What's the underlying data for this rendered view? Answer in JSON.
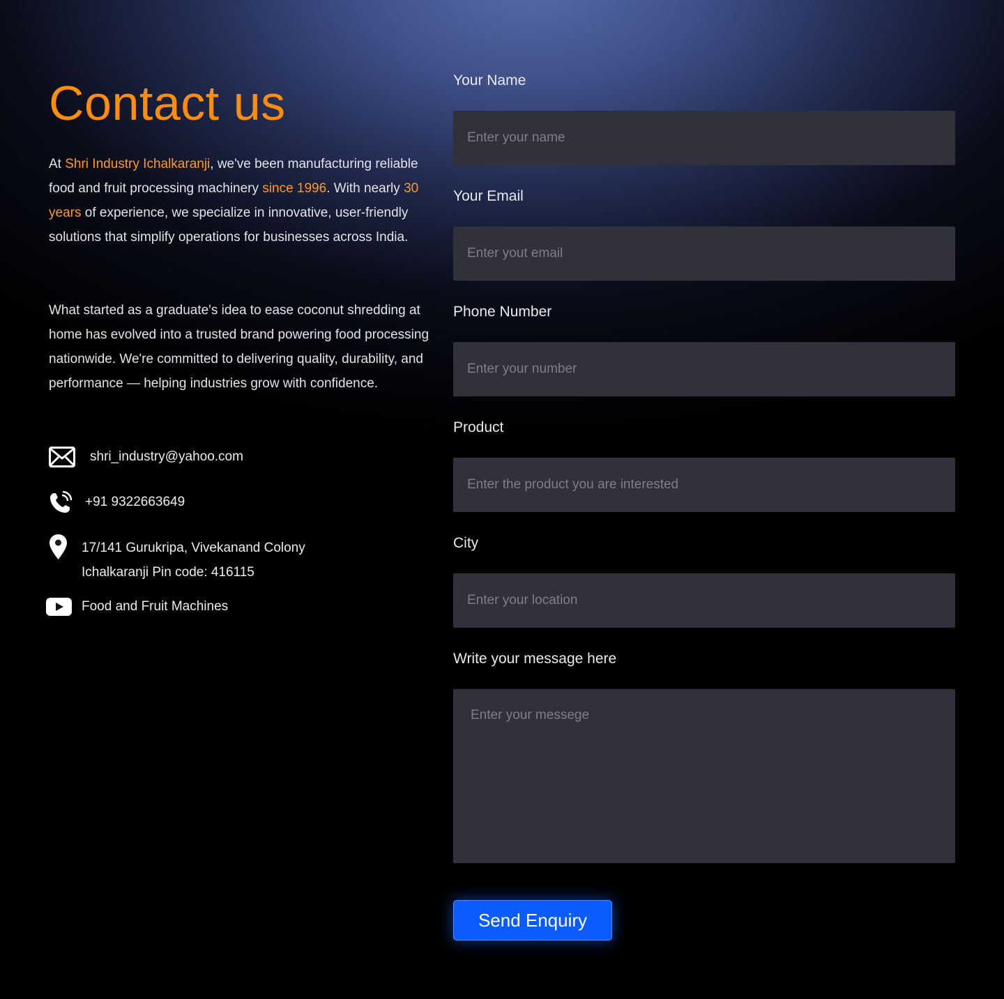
{
  "contact": {
    "title": "Contact us",
    "intro": {
      "p1_at": "At ",
      "p1_company": "Shri Industry Ichalkaranji",
      "p1_mid": ", we've been manufacturing reliable food and fruit processing machinery ",
      "p1_since": "since 1996",
      "p1_mid2": ". With nearly ",
      "p1_years": "30 years",
      "p1_end": " of experience, we specialize in innovative, user-friendly solutions that simplify operations for businesses across India.",
      "p2": "What started as a graduate's idea to ease coconut shredding at home has evolved into a trusted brand powering food processing nationwide. We're committed to delivering quality, durability, and performance — helping industries grow with confidence."
    },
    "details": {
      "email": "shri_industry@yahoo.com",
      "phone": "+91 9322663649",
      "address_line1": "17/141 Gurukripa, Vivekanand Colony",
      "address_line2": "Ichalkaranji Pin code: 416115",
      "youtube": "Food and Fruit Machines"
    },
    "icons": {
      "email": "mail-icon",
      "phone": "phone-icon",
      "address": "location-pin-icon",
      "youtube": "youtube-icon"
    }
  },
  "form": {
    "name_label": "Your Name",
    "name_placeholder": "Enter your name",
    "email_label": "Your Email",
    "email_placeholder": "Enter yout email",
    "phone_label": "Phone Number",
    "phone_placeholder": "Enter your number",
    "product_label": "Product",
    "product_placeholder": "Enter the product you are interested",
    "city_label": "City",
    "city_placeholder": "Enter your location",
    "message_label": "Write your message here",
    "message_placeholder": "Enter your messege",
    "submit_label": "Send Enquiry"
  },
  "colors": {
    "accent": "#ff8c0a",
    "button": "#0b5cff",
    "field_bg": "#31313c"
  }
}
